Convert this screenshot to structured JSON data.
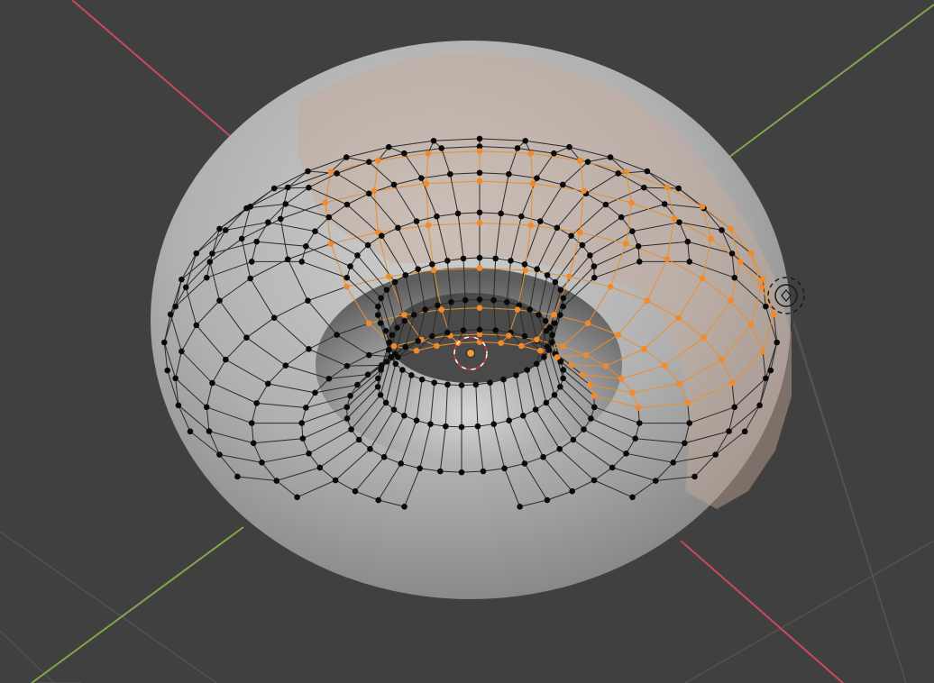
{
  "app": {
    "name": "",
    "view": "",
    "mode": "",
    "select_mode": ""
  },
  "viewport": {
    "background_color": "#404040",
    "grid_line_color": "#555555",
    "x_axis_color": "#c94a5a",
    "y_axis_color": "#7fa64a",
    "origin_color": "#f29a3a"
  },
  "mesh": {
    "object_type": "torus",
    "base_color": "#b4b4b4",
    "selected_face_tint": "#c7aa9a",
    "selected_edge_color": "#e8902e",
    "selected_vertex_color": "#f28a2a",
    "vertex_color": "#0a0a0a",
    "wire_color": "#2b2b2b",
    "selection_description": ""
  },
  "gizmos": {
    "cursor_3d": "3d-cursor-icon",
    "light_icon": "light-icon"
  }
}
